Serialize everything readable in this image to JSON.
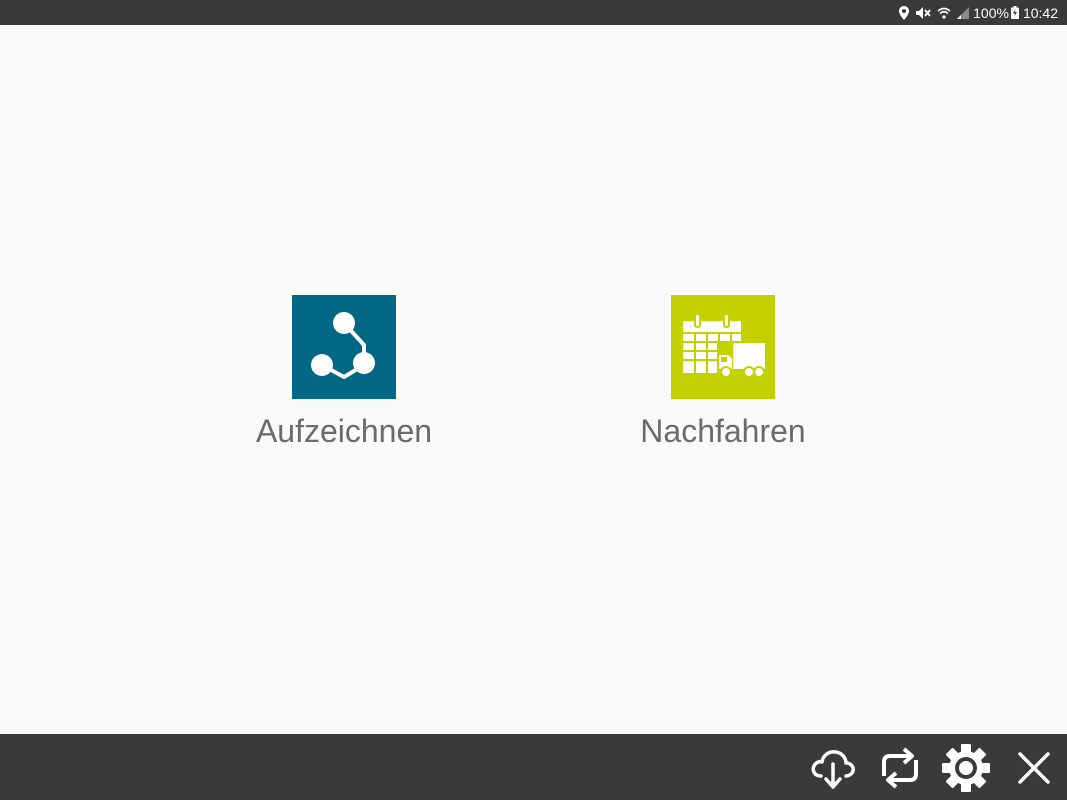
{
  "status_bar": {
    "battery_text": "100%",
    "time": "10:42",
    "icons": [
      "location-icon",
      "mute-icon",
      "wifi-icon",
      "signal-icon",
      "battery-icon"
    ]
  },
  "tiles": [
    {
      "label": "Aufzeichnen",
      "icon": "route-nodes-icon",
      "color": "#006885"
    },
    {
      "label": "Nachfahren",
      "icon": "calendar-truck-icon",
      "color": "#c3d100"
    }
  ],
  "toolbar": {
    "icons": [
      "cloud-download-icon",
      "sync-icon",
      "settings-gear-icon",
      "close-icon"
    ],
    "background": "#3a3a3a"
  }
}
